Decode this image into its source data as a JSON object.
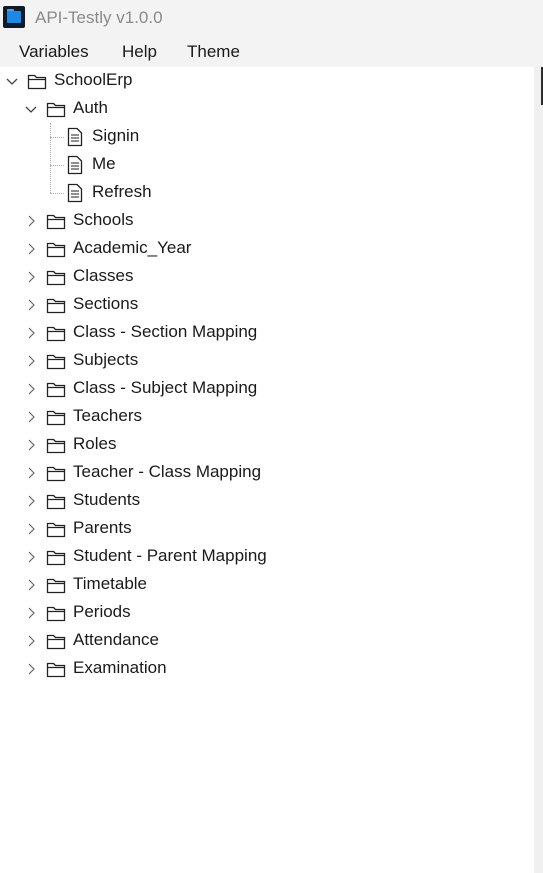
{
  "app": {
    "title": "API-Testly v1.0.0"
  },
  "menu": {
    "items": [
      "Variables",
      "Help",
      "Theme"
    ]
  },
  "tree": {
    "root": {
      "label": "SchoolErp",
      "expanded": true
    },
    "auth": {
      "label": "Auth",
      "expanded": true,
      "requests": [
        "Signin",
        "Me",
        "Refresh"
      ]
    },
    "folders": [
      "Schools",
      "Academic_Year",
      "Classes",
      "Sections",
      "Class - Section Mapping",
      "Subjects",
      "Class - Subject Mapping",
      "Teachers",
      "Roles",
      "Teacher - Class Mapping",
      "Students",
      "Parents",
      "Student - Parent Mapping",
      "Timetable",
      "Periods",
      "Attendance",
      "Examination"
    ]
  },
  "colors": {
    "titlebar_bg": "#f3f3f3",
    "title_text": "#8a8a8a",
    "app_icon_bg": "#0d1b2a",
    "app_icon_accent": "#1e88e5"
  }
}
